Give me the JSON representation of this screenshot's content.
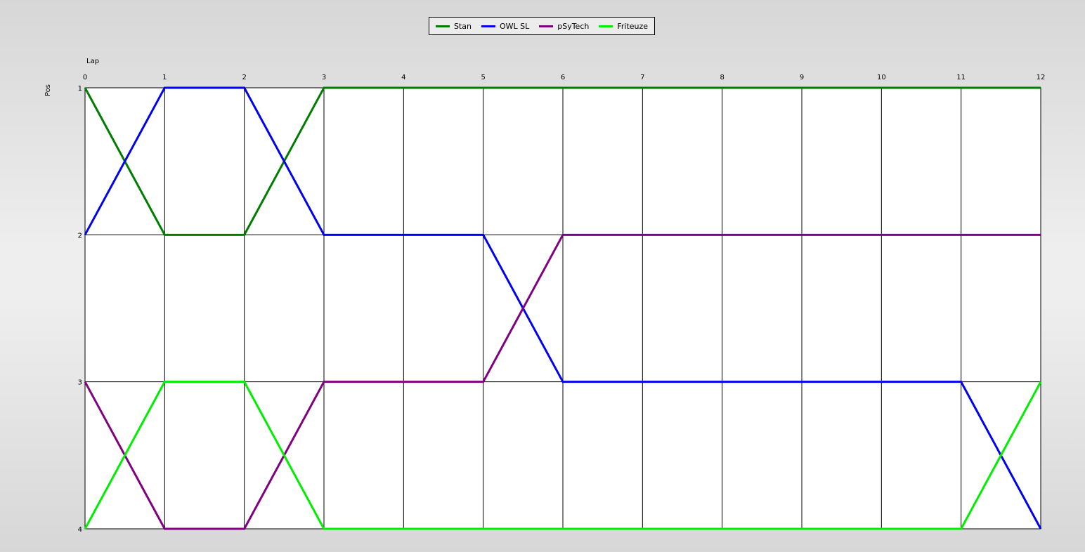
{
  "chart_data": {
    "type": "line",
    "xlabel": "Lap",
    "ylabel": "Pos",
    "x": [
      0,
      1,
      2,
      3,
      4,
      5,
      6,
      7,
      8,
      9,
      10,
      11,
      12
    ],
    "xlim": [
      0,
      12
    ],
    "ylim": [
      1,
      4
    ],
    "y_inverted": true,
    "x_ticks": [
      "0",
      "1",
      "2",
      "3",
      "4",
      "5",
      "6",
      "7",
      "8",
      "9",
      "10",
      "11",
      "12"
    ],
    "y_ticks": [
      "1",
      "2",
      "3",
      "4"
    ],
    "grid": true,
    "legend_position": "top-center",
    "series": [
      {
        "name": "Stan",
        "color": "#007c00",
        "values": [
          1,
          2,
          2,
          1,
          1,
          1,
          1,
          1,
          1,
          1,
          1,
          1,
          1
        ]
      },
      {
        "name": "OWL SL",
        "color": "#0000ee",
        "values": [
          2,
          1,
          1,
          2,
          2,
          2,
          3,
          3,
          3,
          3,
          3,
          3,
          4
        ]
      },
      {
        "name": "pSyTech",
        "color": "#800080",
        "values": [
          3,
          4,
          4,
          3,
          3,
          3,
          2,
          2,
          2,
          2,
          2,
          2,
          2
        ]
      },
      {
        "name": "Friteuze",
        "color": "#00ee00",
        "values": [
          4,
          3,
          3,
          4,
          4,
          4,
          4,
          4,
          4,
          4,
          4,
          4,
          3
        ]
      }
    ]
  }
}
